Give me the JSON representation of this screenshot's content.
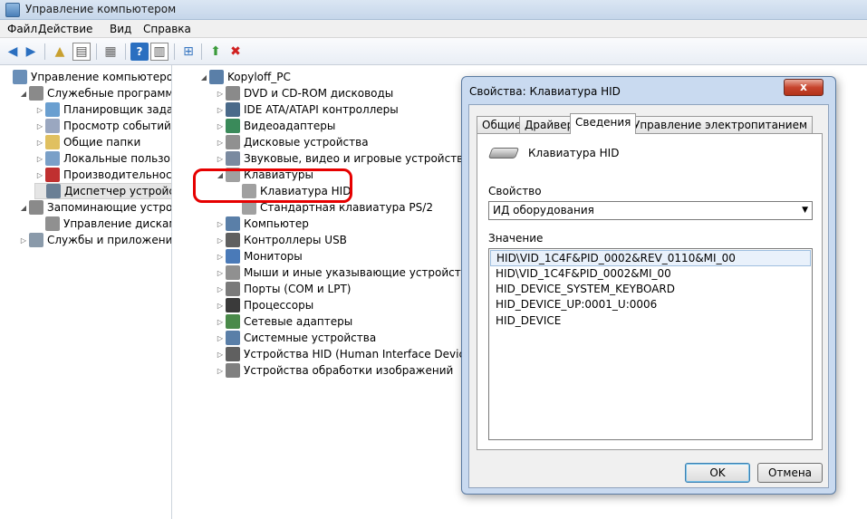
{
  "window": {
    "title": "Управление компьютером"
  },
  "menu": [
    "Файл",
    "Действие",
    "Вид",
    "Справка"
  ],
  "left_tree": [
    {
      "label": "Управление компьютером (л",
      "level": 0,
      "arrow": "",
      "color": "#6a8fb8"
    },
    {
      "label": "Служебные программы",
      "level": 1,
      "arrow": "◢",
      "color": "#8a8a8a"
    },
    {
      "label": "Планировщик заданий",
      "level": 2,
      "arrow": "▷",
      "color": "#6a9fd0"
    },
    {
      "label": "Просмотр событий",
      "level": 2,
      "arrow": "▷",
      "color": "#9aa7c0"
    },
    {
      "label": "Общие папки",
      "level": 2,
      "arrow": "▷",
      "color": "#e0c060"
    },
    {
      "label": "Локальные пользовате",
      "level": 2,
      "arrow": "▷",
      "color": "#7aa0c8"
    },
    {
      "label": "Производительность",
      "level": 2,
      "arrow": "▷",
      "color": "#c03030"
    },
    {
      "label": "Диспетчер устройств",
      "level": 2,
      "arrow": "",
      "color": "#6a7f95",
      "selected": true
    },
    {
      "label": "Запоминающие устройст",
      "level": 1,
      "arrow": "◢",
      "color": "#8a8a8a"
    },
    {
      "label": "Управление дисками",
      "level": 2,
      "arrow": "",
      "color": "#909090"
    },
    {
      "label": "Службы и приложения",
      "level": 1,
      "arrow": "▷",
      "color": "#8a9aaa"
    }
  ],
  "device_tree": [
    {
      "label": "Kopyloff_PC",
      "level": 0,
      "arrow": "◢",
      "color": "#5a7fa8"
    },
    {
      "label": "DVD и CD-ROM дисководы",
      "level": 1,
      "arrow": "▷",
      "color": "#8a8a8a"
    },
    {
      "label": "IDE ATA/ATAPI контроллеры",
      "level": 1,
      "arrow": "▷",
      "color": "#4a6a8a"
    },
    {
      "label": "Видеоадаптеры",
      "level": 1,
      "arrow": "▷",
      "color": "#3a8a5a"
    },
    {
      "label": "Дисковые устройства",
      "level": 1,
      "arrow": "▷",
      "color": "#909090"
    },
    {
      "label": "Звуковые, видео и игровые устройства",
      "level": 1,
      "arrow": "▷",
      "color": "#7a8aa0"
    },
    {
      "label": "Клавиатуры",
      "level": 1,
      "arrow": "◢",
      "color": "#a0a0a0"
    },
    {
      "label": "Клавиатура HID",
      "level": 2,
      "arrow": "",
      "color": "#a0a0a0"
    },
    {
      "label": "Стандартная клавиатура PS/2",
      "level": 2,
      "arrow": "",
      "color": "#a0a0a0"
    },
    {
      "label": "Компьютер",
      "level": 1,
      "arrow": "▷",
      "color": "#5a7fa8"
    },
    {
      "label": "Контроллеры USB",
      "level": 1,
      "arrow": "▷",
      "color": "#606060"
    },
    {
      "label": "Мониторы",
      "level": 1,
      "arrow": "▷",
      "color": "#4a7ab8"
    },
    {
      "label": "Мыши и иные указывающие устройства",
      "level": 1,
      "arrow": "▷",
      "color": "#909090"
    },
    {
      "label": "Порты (COM и LPT)",
      "level": 1,
      "arrow": "▷",
      "color": "#7a7a7a"
    },
    {
      "label": "Процессоры",
      "level": 1,
      "arrow": "▷",
      "color": "#3a3a3a"
    },
    {
      "label": "Сетевые адаптеры",
      "level": 1,
      "arrow": "▷",
      "color": "#4a8a4a"
    },
    {
      "label": "Системные устройства",
      "level": 1,
      "arrow": "▷",
      "color": "#5a7fa8"
    },
    {
      "label": "Устройства HID (Human Interface Devices)",
      "level": 1,
      "arrow": "▷",
      "color": "#606060"
    },
    {
      "label": "Устройства обработки изображений",
      "level": 1,
      "arrow": "▷",
      "color": "#808080"
    }
  ],
  "dialog": {
    "title": "Свойства: Клавиатура HID",
    "close": "x",
    "tabs": [
      "Общие",
      "Драйвер",
      "Сведения",
      "Управление электропитанием"
    ],
    "active_tab": "Сведения",
    "device_name": "Клавиатура HID",
    "property_label": "Свойство",
    "property_value": "ИД оборудования",
    "value_label": "Значение",
    "values": [
      "HID\\VID_1C4F&PID_0002&REV_0110&MI_00",
      "HID\\VID_1C4F&PID_0002&MI_00",
      "HID_DEVICE_SYSTEM_KEYBOARD",
      "HID_DEVICE_UP:0001_U:0006",
      "HID_DEVICE"
    ],
    "ok": "OK",
    "cancel": "Отмена"
  },
  "icons": {
    "back": "back-arrow-icon",
    "forward": "forward-arrow-icon",
    "accent": "#3a78c2"
  }
}
